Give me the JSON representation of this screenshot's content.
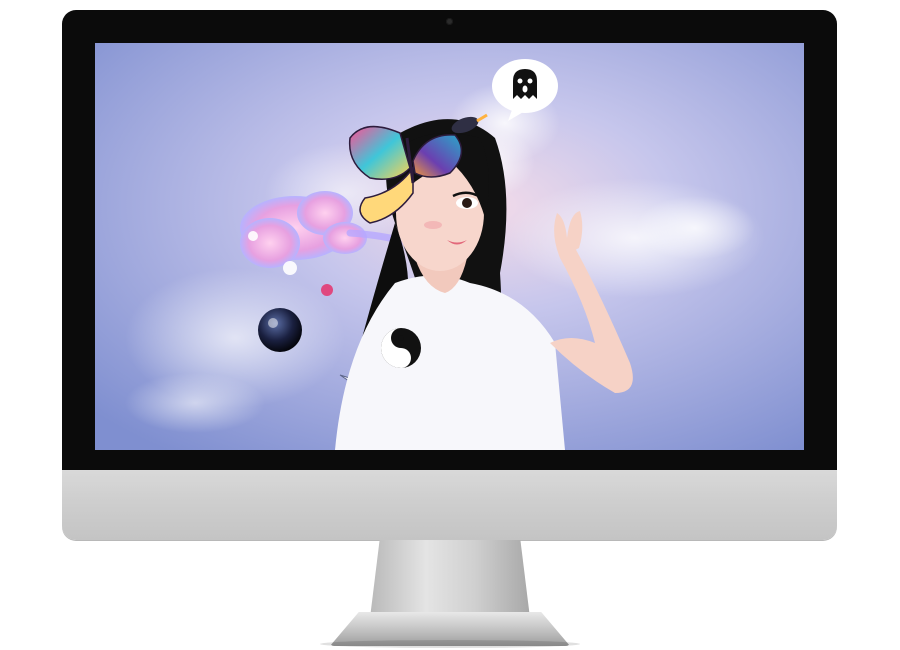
{
  "device": {
    "type": "desktop-monitor",
    "bezel_color": "#0b0b0b",
    "chin_color": "#cfcfcf",
    "stand_color": "#c8c8c8"
  },
  "wallpaper": {
    "style": "illustrated-collage",
    "background_colors": [
      "#7f8fd0",
      "#b9bde8",
      "#f0d6e6"
    ],
    "elements": [
      "girl-with-black-hair",
      "butterfly-mask",
      "speech-bubble-ghost",
      "pink-cloud",
      "white-clouds",
      "dark-planet",
      "small-orbs",
      "paper-plane",
      "rocket",
      "yin-yang-shirt-logo"
    ],
    "speech_bubble_glyph": "👻"
  }
}
